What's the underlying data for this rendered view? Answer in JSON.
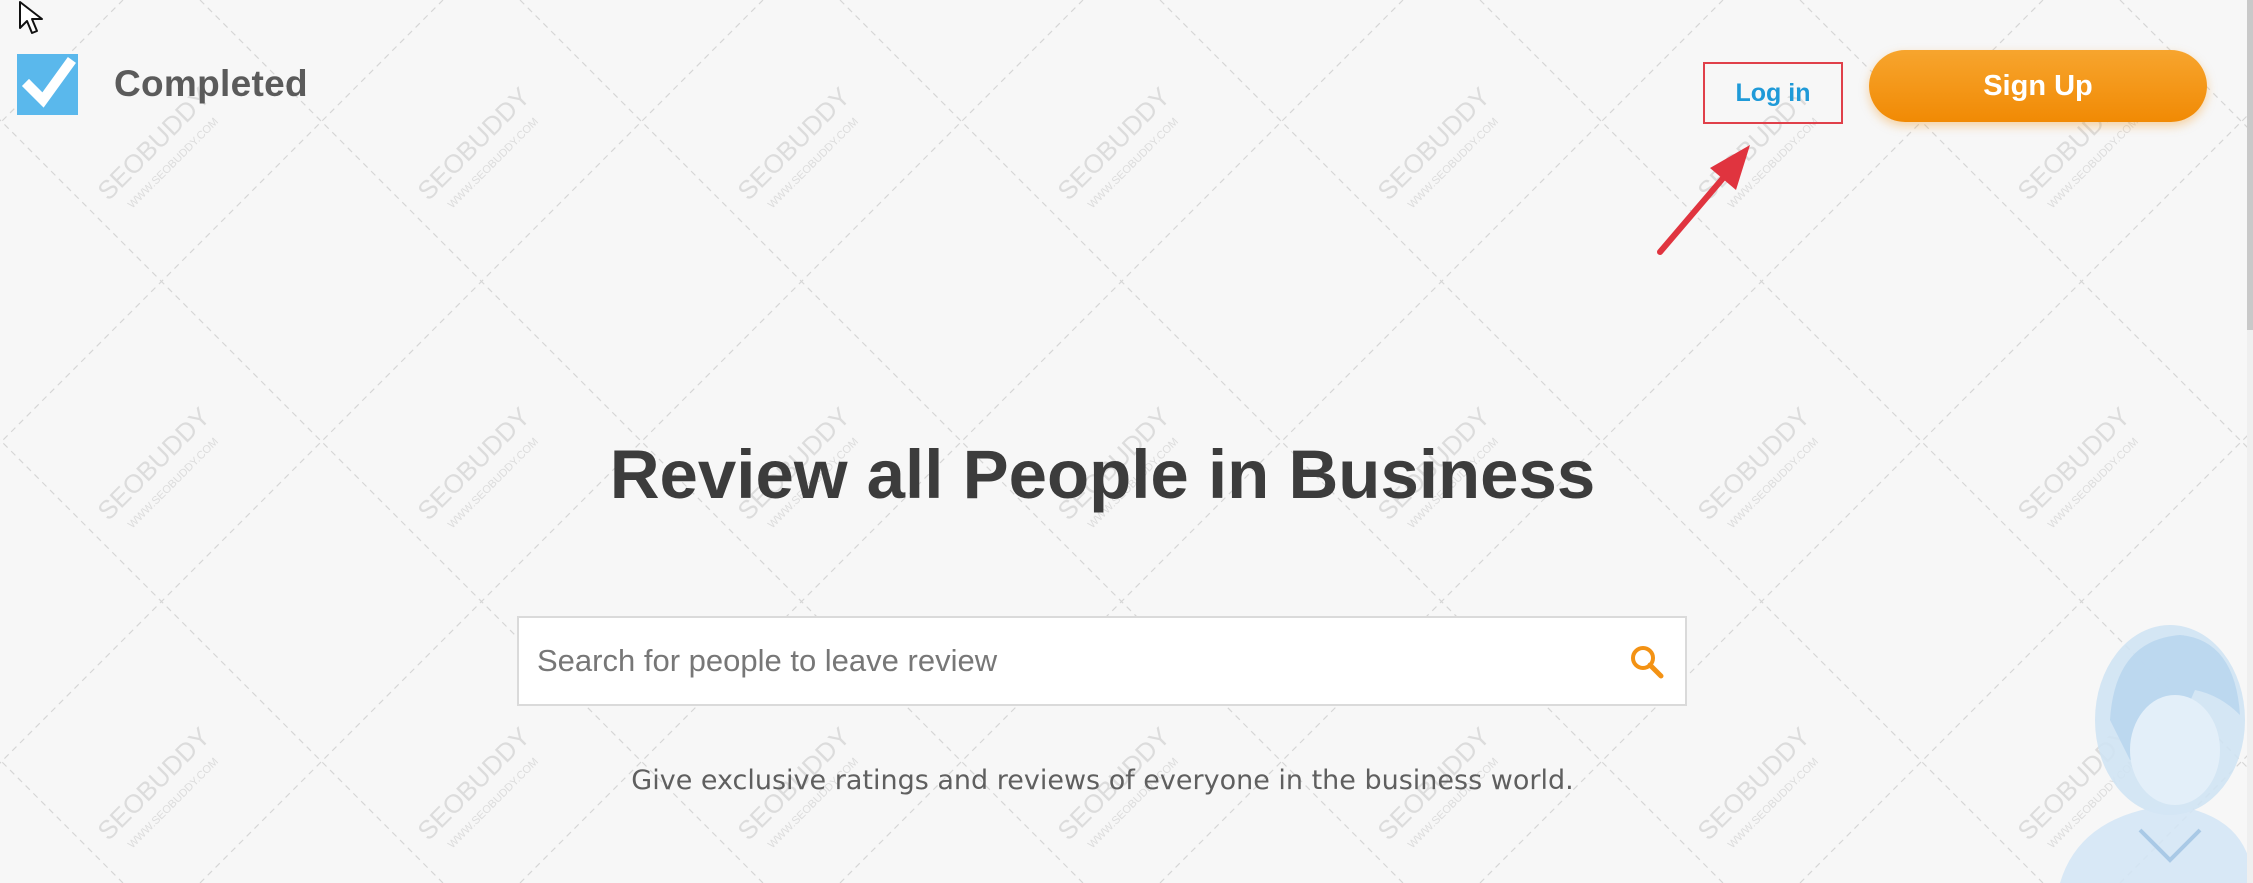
{
  "brand": {
    "name": "Completed",
    "logo_icon": "checkbox-check-icon",
    "logo_color": "#5ab8ec"
  },
  "header": {
    "login_label": "Log in",
    "signup_label": "Sign Up",
    "signup_color": "#f39214",
    "login_color": "#1f9ad8",
    "highlight_color": "#e0404a"
  },
  "hero": {
    "title": "Review all People in Business",
    "subtitle": "Give exclusive ratings and reviews of everyone in the business world."
  },
  "search": {
    "placeholder": "Search for people to leave review",
    "value": "",
    "icon": "search-icon",
    "icon_color": "#f39214"
  },
  "watermark": {
    "brand": "SEOBUDDY",
    "url": "WWW.SEOBUDDY.COM"
  }
}
